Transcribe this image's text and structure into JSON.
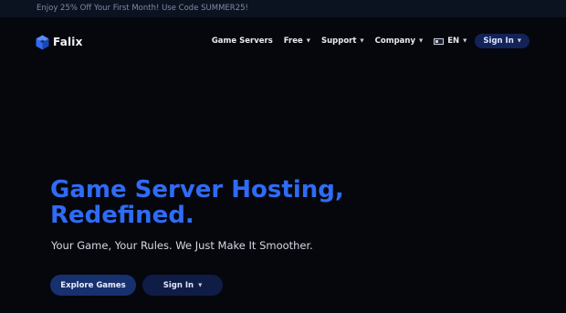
{
  "promo": {
    "text": "Enjoy 25% Off Your First Month! Use Code SUMMER25!"
  },
  "brand": {
    "name": "Falix",
    "logo_icon": "cube-logo-icon",
    "accent_color": "#2f6bf5"
  },
  "nav": {
    "items": [
      {
        "label": "Game Servers",
        "has_dropdown": false
      },
      {
        "label": "Free",
        "has_dropdown": true
      },
      {
        "label": "Support",
        "has_dropdown": true
      },
      {
        "label": "Company",
        "has_dropdown": true
      }
    ],
    "language": {
      "label": "EN",
      "icon": "flag-icon"
    },
    "signin_label": "Sign In"
  },
  "hero": {
    "title_line1": "Game Server Hosting,",
    "title_line2": "Redefined.",
    "subtitle": "Your Game, Your Rules. We Just Make It Smoother.",
    "explore_label": "Explore Games",
    "signin_label": "Sign In"
  }
}
